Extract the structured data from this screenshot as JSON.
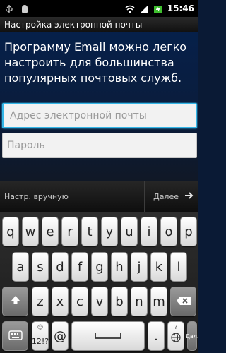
{
  "status_bar": {
    "time": "15:46",
    "left_icons": [
      "usb-icon",
      "android-icon"
    ],
    "right_icons": [
      "wifi-icon",
      "signal-icon",
      "battery-icon"
    ]
  },
  "title_bar": {
    "title": "Настройка электронной почты"
  },
  "main": {
    "intro_text": "Программу Email можно легко настроить для большинства популярных почтовых служб.",
    "email_field": {
      "placeholder": "Адрес электронной почты",
      "value": ""
    },
    "password_field": {
      "placeholder": "Пароль",
      "value": ""
    }
  },
  "action_bar": {
    "manual_setup_label": "Настр. вручную",
    "next_label": "Далее",
    "next_icon": "arrow-right-icon"
  },
  "keyboard": {
    "row1": [
      "q",
      "w",
      "e",
      "r",
      "t",
      "y",
      "u",
      "i",
      "o",
      "p"
    ],
    "row2": [
      "a",
      "s",
      "d",
      "f",
      "g",
      "h",
      "j",
      "k",
      "l"
    ],
    "row3": [
      "z",
      "x",
      "c",
      "v",
      "b",
      "n",
      "m"
    ],
    "shift_icon": "shift-icon",
    "backspace_icon": "backspace-icon",
    "keyboard_icon": "keyboard-icon",
    "symbols_sub": "☺",
    "symbols_label": "12!?",
    "at": "@",
    "space_icon": "space-icon",
    "dot": ".",
    "globe_sub": "?",
    "globe_icon": "globe-icon",
    "done_label": "Дал."
  },
  "colors": {
    "background": "#0a1a35",
    "focus_border": "#35b7e8",
    "action_bar": "#1a1a1a"
  }
}
